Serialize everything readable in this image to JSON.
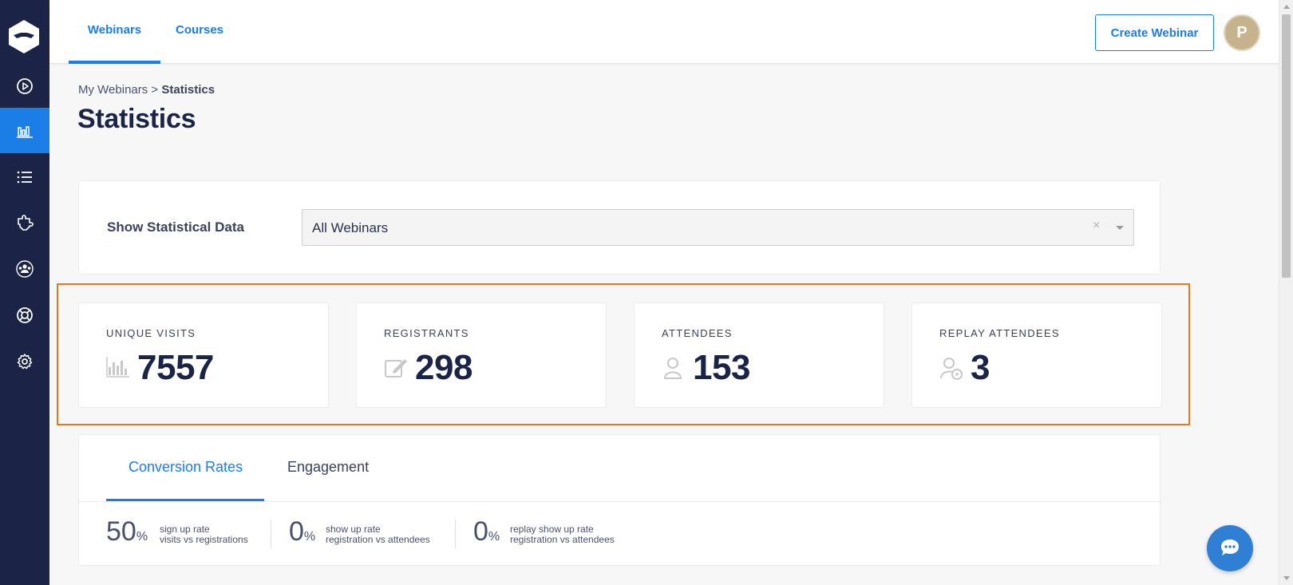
{
  "topbar": {
    "tabs": [
      "Webinars",
      "Courses"
    ],
    "create_button": "Create Webinar",
    "avatar_initial": "P"
  },
  "sidebar": {
    "items": [
      "play-circle-icon",
      "bar-chart-icon",
      "list-icon",
      "puzzle-icon",
      "users-icon",
      "lifebuoy-icon",
      "gear-icon"
    ],
    "active_index": 1
  },
  "breadcrumb": {
    "parent": "My Webinars",
    "separator": ">",
    "current": "Statistics"
  },
  "page_title": "Statistics",
  "filter": {
    "label": "Show Statistical Data",
    "selected": "All Webinars",
    "clear": "×"
  },
  "stats": [
    {
      "label": "UNIQUE VISITS",
      "value": "7557",
      "icon": "bar-chart-icon"
    },
    {
      "label": "REGISTRANTS",
      "value": "298",
      "icon": "edit-icon"
    },
    {
      "label": "ATTENDEES",
      "value": "153",
      "icon": "user-icon"
    },
    {
      "label": "REPLAY ATTENDEES",
      "value": "3",
      "icon": "user-replay-icon"
    }
  ],
  "conversion": {
    "tabs": [
      "Conversion Rates",
      "Engagement"
    ],
    "rates": [
      {
        "value": "50",
        "unit": "%",
        "line1": "sign up rate",
        "line2": "visits vs registrations"
      },
      {
        "value": "0",
        "unit": "%",
        "line1": "show up rate",
        "line2": "registration vs attendees"
      },
      {
        "value": "0",
        "unit": "%",
        "line1": "replay show up rate",
        "line2": "registration vs attendees"
      }
    ]
  },
  "colors": {
    "sidebar": "#1b2346",
    "accent": "#1a7ee6",
    "highlight": "#e07a1f",
    "avatar": "#c7b28e",
    "chat": "#2f7fd4"
  }
}
